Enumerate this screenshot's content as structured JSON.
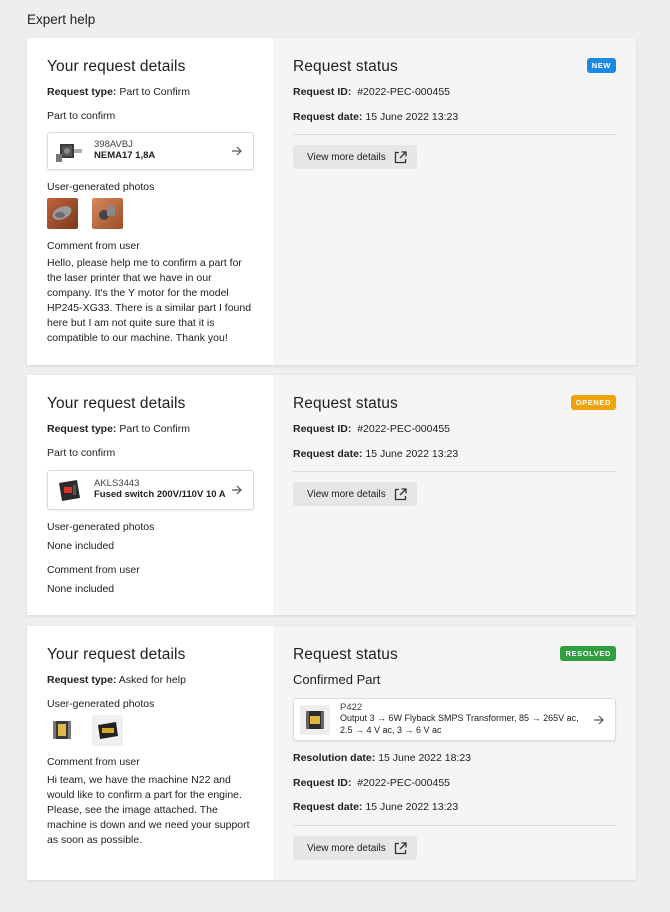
{
  "page_title": "Expert help",
  "cards": [
    {
      "details_title": "Your request details",
      "request_type_label": "Request type:",
      "request_type": "Part to Confirm",
      "part_heading": "Part to confirm",
      "part_code": "398AVBJ",
      "part_name": "NEMA17 1,8A",
      "photos_heading": "User-generated photos",
      "comment_heading": "Comment from user",
      "comment": "Hello, please help me to confirm a part for the laser printer that we have in our company. It's the Y motor for the model HP245-XG33. There is a similar part I found here but I am not quite sure that it is compatible to our machine. Thank you!",
      "status_title": "Request status",
      "badge": "NEW",
      "badge_color": "#1e88e5",
      "request_id_label": "Request ID:",
      "request_id": "#2022-PEC-000455",
      "request_date_label": "Request date:",
      "request_date": "15 June 2022 13:23",
      "view_more": "View more details"
    },
    {
      "details_title": "Your request details",
      "request_type_label": "Request type:",
      "request_type": "Part to Confirm",
      "part_heading": "Part to confirm",
      "part_code": "AKLS3443",
      "part_name": "Fused switch 200V/110V 10 A",
      "photos_heading": "User-generated photos",
      "photos_none": "None included",
      "comment_heading": "Comment from user",
      "comment": "None included",
      "status_title": "Request status",
      "badge": "OPENED",
      "badge_color": "#f0a30a",
      "request_id_label": "Request ID:",
      "request_id": "#2022-PEC-000455",
      "request_date_label": "Request date:",
      "request_date": "15 June 2022 13:23",
      "view_more": "View more details"
    },
    {
      "details_title": "Your request details",
      "request_type_label": "Request type:",
      "request_type": "Asked for help",
      "photos_heading": "User-generated photos",
      "comment_heading": "Comment from user",
      "comment": "Hi team, we have the machine N22 and would like to confirm a part for the engine. Please, see the image attached. The machine is down and we need your support as soon as possible.",
      "status_title": "Request status",
      "badge": "RESOLVED",
      "badge_color": "#2e9e3e",
      "confirmed_heading": "Confirmed Part",
      "part_code": "P422",
      "part_name": "Output 3 → 6W Flyback SMPS Transformer, 85 → 265V ac, 2.5 → 4 V ac, 3 → 6 V ac",
      "resolution_date_label": "Resolution date:",
      "resolution_date": "15 June 2022 18:23",
      "request_id_label": "Request ID:",
      "request_id": "#2022-PEC-000455",
      "request_date_label": "Request date:",
      "request_date": "15 June 2022 13:23",
      "view_more": "View more details"
    }
  ],
  "icons": {
    "arrow": "arrow-right-icon",
    "external": "external-link-icon"
  }
}
